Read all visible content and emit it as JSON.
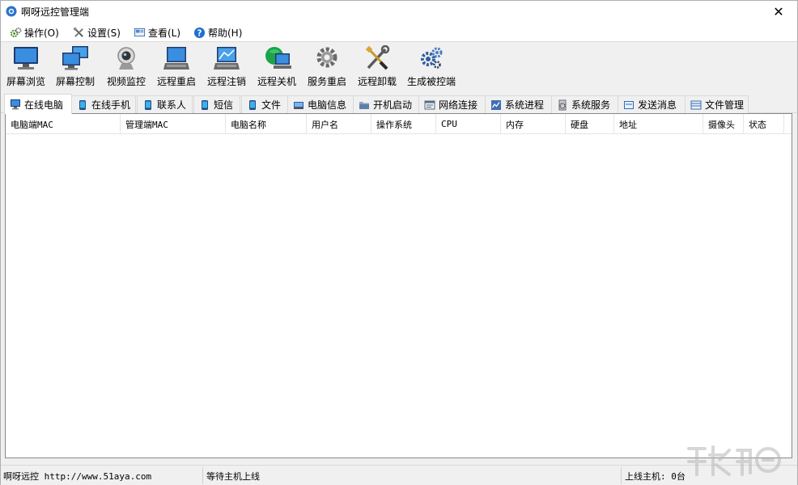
{
  "window": {
    "title": "啊呀远控管理端",
    "close_glyph": "✕"
  },
  "menu": [
    {
      "label": "操作(O)",
      "icon": "gear-cluster-icon"
    },
    {
      "label": "设置(S)",
      "icon": "tools-icon"
    },
    {
      "label": "查看(L)",
      "icon": "view-icon"
    },
    {
      "label": "帮助(H)",
      "icon": "help-icon"
    }
  ],
  "toolbar": [
    {
      "label": "屏幕浏览",
      "icon": "monitor-icon"
    },
    {
      "label": "屏幕控制",
      "icon": "dual-monitor-icon"
    },
    {
      "label": "视频监控",
      "icon": "webcam-icon"
    },
    {
      "label": "远程重启",
      "icon": "restart-pc-icon"
    },
    {
      "label": "远程注销",
      "icon": "logout-pc-icon"
    },
    {
      "label": "远程关机",
      "icon": "shutdown-pc-icon"
    },
    {
      "label": "服务重启",
      "icon": "service-gear-icon"
    },
    {
      "label": "远程卸载",
      "icon": "uninstall-tools-icon"
    },
    {
      "label": "生成被控端",
      "icon": "build-gears-icon"
    }
  ],
  "tabs": [
    {
      "label": "在线电脑",
      "icon": "computer-icon",
      "active": true
    },
    {
      "label": "在线手机",
      "icon": "phone-icon",
      "active": false
    },
    {
      "label": "联系人",
      "icon": "phone-icon",
      "active": false
    },
    {
      "label": "短信",
      "icon": "phone-icon",
      "active": false
    },
    {
      "label": "文件",
      "icon": "phone-icon",
      "active": false
    },
    {
      "label": "电脑信息",
      "icon": "pc-info-icon",
      "active": false
    },
    {
      "label": "开机启动",
      "icon": "folder-icon",
      "active": false
    },
    {
      "label": "网络连接",
      "icon": "network-icon",
      "active": false
    },
    {
      "label": "系统进程",
      "icon": "process-icon",
      "active": false
    },
    {
      "label": "系统服务",
      "icon": "services-icon",
      "active": false
    },
    {
      "label": "发送消息",
      "icon": "message-icon",
      "active": false
    },
    {
      "label": "文件管理",
      "icon": "file-manager-icon",
      "active": false
    }
  ],
  "table": {
    "columns": [
      "电脑端MAC",
      "管理端MAC",
      "电脑名称",
      "用户名",
      "操作系统",
      "CPU",
      "内存",
      "硬盘",
      "地址",
      "摄像头",
      "状态"
    ],
    "rows": []
  },
  "statusbar": {
    "left": "啊呀远控 http://www.51aya.com",
    "middle": "等待主机上线",
    "right": "上线主机: 0台"
  },
  "colors": {
    "accent": "#1f6fd1",
    "selection": "#ffffff",
    "border": "#d9d9d9"
  }
}
